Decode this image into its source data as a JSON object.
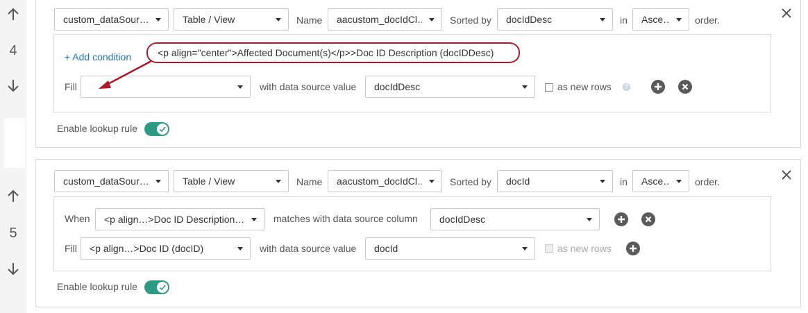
{
  "rules": [
    {
      "number": "4",
      "datasource": "custom_dataSour…",
      "type": "Table / View",
      "name_label": "Name",
      "name_value": "aacustom_docIdCl…",
      "sorted_label": "Sorted by",
      "sorted_value": "docIdDesc",
      "in_label": "in",
      "order_value": "Asce…",
      "order_label": "order.",
      "add_condition": "+ Add condition",
      "fill_label": "Fill",
      "fill_value": "",
      "with_label": "with data source value",
      "with_value": "docIdDesc",
      "as_new_rows": "as new rows",
      "as_new_rows_checked": false,
      "enable_label": "Enable lookup rule",
      "enabled": true
    },
    {
      "number": "5",
      "datasource": "custom_dataSour…",
      "type": "Table / View",
      "name_label": "Name",
      "name_value": "aacustom_docIdCl…",
      "sorted_label": "Sorted by",
      "sorted_value": "docId",
      "in_label": "in",
      "order_value": "Asce…",
      "order_label": "order.",
      "when_label": "When",
      "when_value": "<p align…>Doc ID Description…",
      "matches_label": "matches with data source column",
      "matches_value": "docIdDesc",
      "fill_label": "Fill",
      "fill_value": "<p align…>Doc ID (docID)",
      "with_label": "with data source value",
      "with_value": "docId",
      "as_new_rows": "as new rows",
      "as_new_rows_disabled": true,
      "enable_label": "Enable lookup rule",
      "enabled": true
    }
  ],
  "annotation": {
    "text": "<p align=\"center\">Affected Document(s)</p>>Doc ID Description (docIDDesc)",
    "color": "#b0192c"
  },
  "colors": {
    "accent_link": "#1f74c6",
    "toggle_on": "#2f9a84",
    "border": "#d9d9d9"
  },
  "icons": [
    "arrow-up-icon",
    "arrow-down-icon",
    "close-icon",
    "chevron-down-icon",
    "plus-circle-icon",
    "x-circle-icon",
    "help-icon",
    "check-icon"
  ]
}
